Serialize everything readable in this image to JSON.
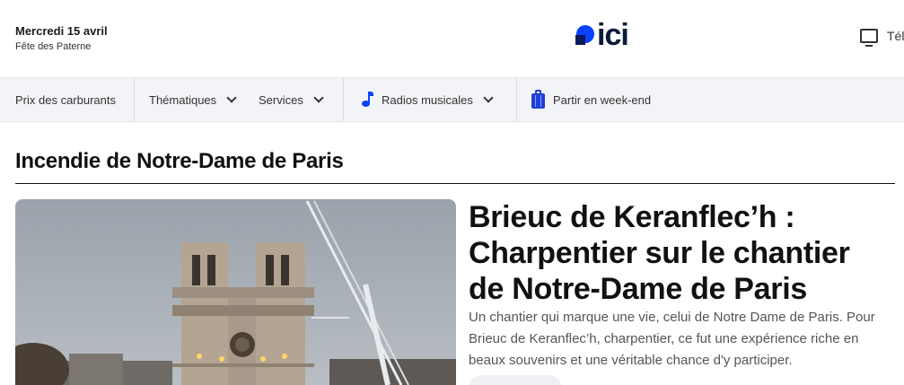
{
  "header": {
    "date": "Mercredi 15 avril",
    "saint_day": "Fête des Paterne",
    "logo_text": "ici",
    "tv_label": "Tél"
  },
  "nav": {
    "items": [
      {
        "label": "Prix des carburants",
        "has_dropdown": false
      },
      {
        "label": "Thématiques",
        "has_dropdown": true
      },
      {
        "label": "Services",
        "has_dropdown": true
      },
      {
        "label": "Radios musicales",
        "has_dropdown": true,
        "icon": "music-note-icon"
      },
      {
        "label": "Partir en week-end",
        "has_dropdown": false,
        "icon": "suitcase-icon"
      }
    ]
  },
  "section": {
    "title": "Incendie de Notre-Dame de Paris"
  },
  "article": {
    "headline": "Brieuc de Keranflec’h : Charpentier sur le chantier de Notre-Dame de Paris",
    "summary": "Un chantier qui marque une vie, celui de Notre Dame de Paris. Pour Brieuc de Keranflec’h, charpentier, ce fut une expérience riche en beaux souvenirs et une véritable chance d'y participer.",
    "image_subject": "Notre-Dame de Paris façade with construction crane at dusk"
  },
  "colors": {
    "brand_blue": "#0a42ff",
    "brand_dark": "#0a1a3c",
    "nav_bg": "#f3f4f7",
    "text_dark": "#111111",
    "text_muted": "#555555"
  }
}
